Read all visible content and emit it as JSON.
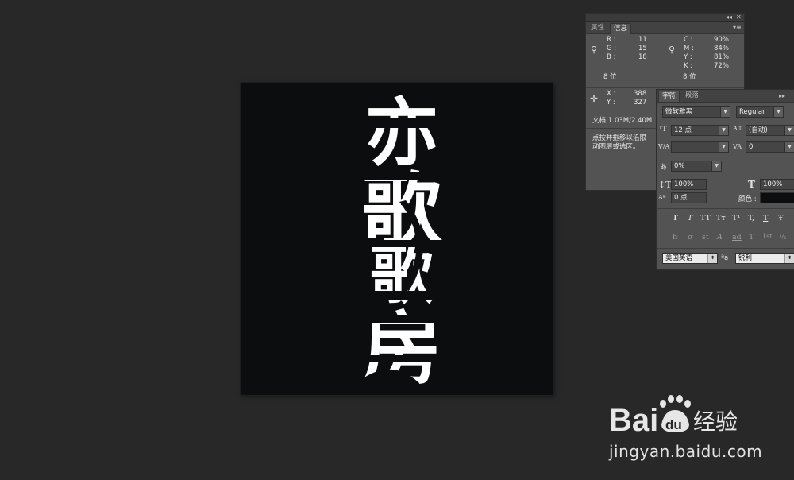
{
  "canvas": {
    "background": "#0b0d0f",
    "artwork_text": [
      "亦",
      "歌",
      "歌",
      "房"
    ],
    "artwork_color": "#ffffff"
  },
  "info_panel": {
    "tabs": [
      {
        "label": "属性"
      },
      {
        "label": "信息"
      }
    ],
    "active_tab": "信息",
    "rgb": {
      "r_label": "R :",
      "r": "11",
      "g_label": "G :",
      "g": "15",
      "b_label": "B :",
      "b": "18"
    },
    "cmyk": {
      "c_label": "C :",
      "c": "90%",
      "m_label": "M :",
      "m": "84%",
      "y_label": "Y :",
      "y": "81%",
      "k_label": "K :",
      "k": "72%"
    },
    "bit_left": "8 位",
    "bit_right": "8 位",
    "coords": {
      "x_label": "X :",
      "x": "388",
      "y_label": "Y :",
      "y": "327"
    },
    "doc": "文档:1.03M/2.40M",
    "hint_line1": "点按并拖移以沿限",
    "hint_line2": "动图层或选区。"
  },
  "character_panel": {
    "tabs": [
      {
        "label": "字符"
      },
      {
        "label": "段落"
      }
    ],
    "font_family": "微软雅黑",
    "font_style": "Regular",
    "font_size": "12 点",
    "leading": "(自动)",
    "kerning": "",
    "tracking": "0",
    "tsume": "0%",
    "vertical_scale": "100%",
    "horizontal_scale": "100%",
    "baseline_shift": "0 点",
    "color_label": "颜色 :",
    "color_value": "#0b0d0f",
    "style_buttons": [
      "T",
      "T",
      "TT",
      "Tт",
      "T¹",
      "T,",
      "T",
      "Ŧ"
    ],
    "opentype_buttons": [
      "fi",
      "ơ",
      "st",
      "A",
      "ad",
      "T",
      "1st",
      "½"
    ],
    "language": "美国英语",
    "aa_label": "ªa",
    "antialias": "锐利"
  },
  "watermark": {
    "brand": "Bai",
    "brand2": "du",
    "cn": "经验",
    "url": "jingyan.baidu.com"
  }
}
